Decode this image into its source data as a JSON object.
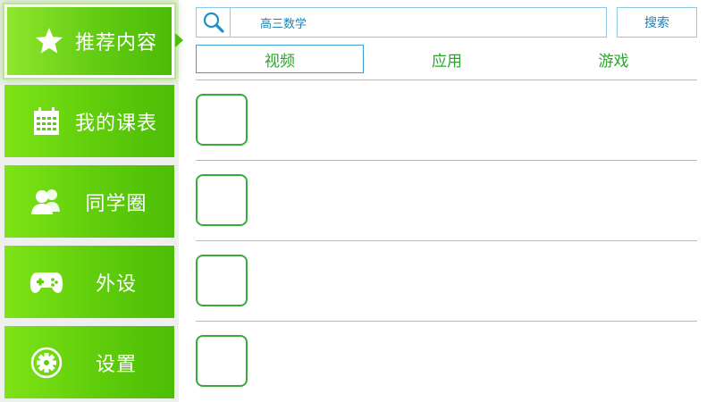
{
  "sidebar": {
    "items": [
      {
        "label": "推荐内容",
        "icon": "star-icon",
        "active": true
      },
      {
        "label": "我的课表",
        "icon": "calendar-icon",
        "active": false
      },
      {
        "label": "同学圈",
        "icon": "users-icon",
        "active": false
      },
      {
        "label": "外设",
        "icon": "gamepad-icon",
        "active": false
      },
      {
        "label": "设置",
        "icon": "gear-icon",
        "active": false
      }
    ]
  },
  "search": {
    "value": "高三数学",
    "button_label": "搜索",
    "icon": "search-icon"
  },
  "tabs": [
    {
      "label": "视频",
      "active": true
    },
    {
      "label": "应用",
      "active": false
    },
    {
      "label": "游戏",
      "active": false
    }
  ],
  "colors": {
    "sidebar_green": "#5fcd0b",
    "tab_text": "#2aa52a",
    "border_blue": "#8dc8e6",
    "search_text": "#1f7fb3"
  }
}
